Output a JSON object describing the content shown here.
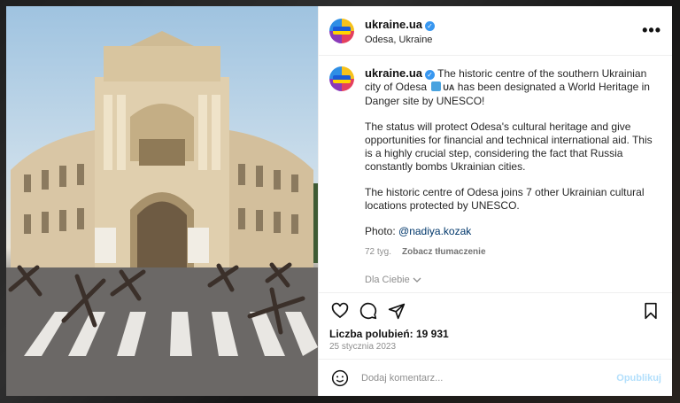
{
  "post": {
    "username": "ukraine.ua",
    "location": "Odesa, Ukraine",
    "more_glyph": "•••",
    "verified_glyph": "✓"
  },
  "caption": {
    "username": "ukraine.ua",
    "p1_a": "The historic centre of the southern Ukrainian city of Odesa",
    "p1_flag": "UA",
    "p1_b": "has been designated a World Heritage in Danger site by UNESCO!",
    "p2": "The status will protect Odesa's cultural heritage and give opportunities for financial and technical international aid. This is a highly crucial step, considering the fact that Russia constantly bombs Ukrainian cities.",
    "p3": "The historic centre of Odesa joins 7 other Ukrainian cultural locations protected by UNESCO.",
    "photo_label": "Photo: ",
    "photo_handle": "@nadiya.kozak",
    "age": "72 tyg.",
    "translate": "Zobacz tłumaczenie"
  },
  "for_you": "Dla Ciebie",
  "engagement": {
    "likes": "Liczba polubień: 19 931",
    "date": "25 stycznia 2023"
  },
  "comment": {
    "placeholder": "Dodaj komentarz...",
    "post_label": "Opublikuj"
  },
  "icons": [
    "heart-icon",
    "comment-icon",
    "share-icon",
    "bookmark-icon",
    "emoji-icon",
    "chevron-down-icon",
    "verified-icon"
  ],
  "colors": {
    "verified": "#3897f0",
    "link": "#00376b",
    "post_button_disabled": "#b2dffc",
    "muted": "#8e8e8e"
  }
}
